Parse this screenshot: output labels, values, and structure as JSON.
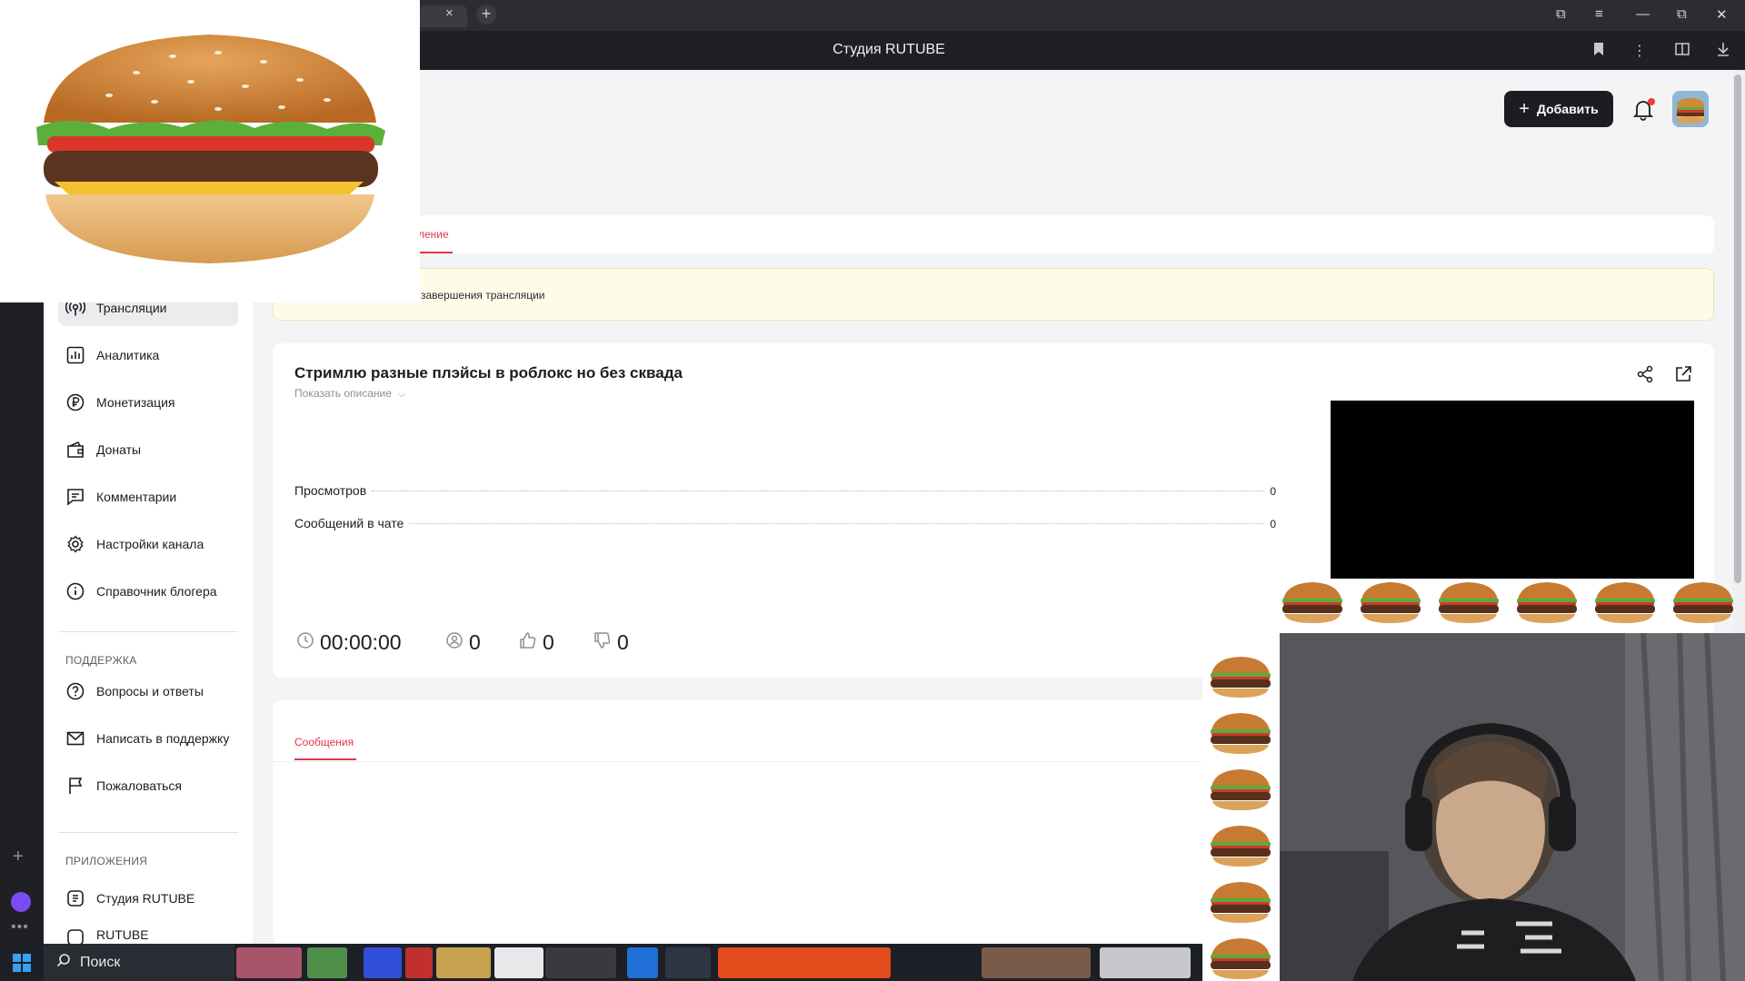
{
  "browser": {
    "window_title": "Студия RUTUBE",
    "tab_close": "×",
    "new_tab": "+",
    "controls": [
      "⧉",
      "≡",
      "—",
      "⧉",
      "✕"
    ]
  },
  "header": {
    "add_button": "Добавить",
    "add_icon": "+"
  },
  "tabs": {
    "active_tab_visible_text": "ление"
  },
  "warning": {
    "visible_text": "завершения трансляции"
  },
  "sidebar": {
    "items": [
      {
        "label": "Трансляции",
        "icon": "broadcast-icon",
        "active": true
      },
      {
        "label": "Аналитика",
        "icon": "analytics-icon"
      },
      {
        "label": "Монетизация",
        "icon": "ruble-icon"
      },
      {
        "label": "Донаты",
        "icon": "wallet-icon"
      },
      {
        "label": "Комментарии",
        "icon": "comment-icon"
      },
      {
        "label": "Настройки канала",
        "icon": "gear-icon"
      },
      {
        "label": "Справочник блогера",
        "icon": "info-icon"
      }
    ],
    "support_header": "ПОДДЕРЖКА",
    "support_items": [
      {
        "label": "Вопросы и ответы",
        "icon": "question-icon"
      },
      {
        "label": "Написать в поддержку",
        "icon": "mail-icon"
      },
      {
        "label": "Пожаловаться",
        "icon": "flag-icon"
      }
    ],
    "apps_header": "ПРИЛОЖЕНИЯ",
    "apps_items": [
      {
        "label": "Студия RUTUBE",
        "icon": "studio-icon"
      },
      {
        "label": "RUTUBE",
        "icon": "rutube-icon"
      }
    ]
  },
  "stream": {
    "title": "Стримлю разные плэйсы в роблокс но без сквада",
    "show_description": "Показать описание",
    "stats": [
      {
        "label": "Просмотров",
        "value": "0"
      },
      {
        "label": "Сообщений в чате",
        "value": "0"
      }
    ],
    "duration": "00:00:00",
    "viewers": "0",
    "likes": "0",
    "dislikes": "0"
  },
  "messages": {
    "tab": "Сообщения"
  },
  "taskbar": {
    "search_placeholder": "Поиск"
  },
  "colors": {
    "accent": "#e0364c",
    "dark": "#1b1d21",
    "warning_bg": "#fffbe9"
  }
}
